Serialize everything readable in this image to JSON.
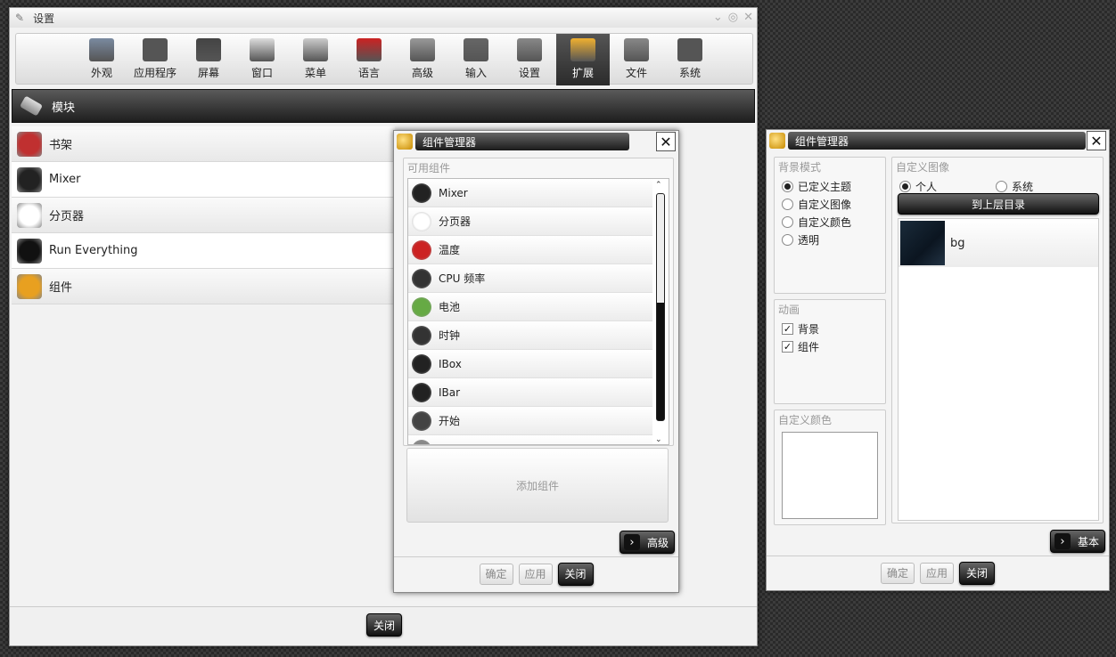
{
  "settings": {
    "title": "设置",
    "toolbar": [
      {
        "label": "外观",
        "icon": "appearance-icon",
        "color": "#7a8aa0"
      },
      {
        "label": "应用程序",
        "icon": "play-icon",
        "color": "#555555"
      },
      {
        "label": "屏幕",
        "icon": "monitor-icon",
        "color": "#444444"
      },
      {
        "label": "窗口",
        "icon": "window-icon",
        "color": "#dddddd"
      },
      {
        "label": "菜单",
        "icon": "menu-icon",
        "color": "#cccccc"
      },
      {
        "label": "语言",
        "icon": "flag-icon",
        "color": "#cc2222"
      },
      {
        "label": "高级",
        "icon": "rocket-icon",
        "color": "#999999"
      },
      {
        "label": "输入",
        "icon": "keyboard-icon",
        "color": "#666666"
      },
      {
        "label": "设置",
        "icon": "wrench-icon",
        "color": "#888888"
      },
      {
        "label": "扩展",
        "icon": "puzzle-icon",
        "color": "#f0b030",
        "active": true
      },
      {
        "label": "文件",
        "icon": "folder-icon",
        "color": "#888888"
      },
      {
        "label": "系统",
        "icon": "laptop-icon",
        "color": "#555555"
      }
    ],
    "section_title": "模块",
    "modules": [
      {
        "label": "书架",
        "icon": "bookshelf-icon",
        "color": "#c03030"
      },
      {
        "label": "Mixer",
        "icon": "speaker-icon",
        "color": "#222222"
      },
      {
        "label": "分页器",
        "icon": "pager-icon",
        "color": "#ffffff"
      },
      {
        "label": "Run Everything",
        "icon": "terminal-icon",
        "color": "#111111"
      },
      {
        "label": "组件",
        "icon": "gadgets-icon",
        "color": "#e8a020"
      }
    ],
    "close_label": "关闭"
  },
  "cm1": {
    "title": "组件管理器",
    "available_label": "可用组件",
    "components": [
      {
        "label": "Mixer",
        "icon": "speaker-icon",
        "color": "#222222"
      },
      {
        "label": "分页器",
        "icon": "pager-icon",
        "color": "#ffffff"
      },
      {
        "label": "温度",
        "icon": "thermometer-icon",
        "color": "#cc2222"
      },
      {
        "label": "CPU 频率",
        "icon": "gauge-icon",
        "color": "#333333"
      },
      {
        "label": "电池",
        "icon": "battery-icon",
        "color": "#66aa44"
      },
      {
        "label": "时钟",
        "icon": "clock-icon",
        "color": "#333333"
      },
      {
        "label": "IBox",
        "icon": "ibox-icon",
        "color": "#222222"
      },
      {
        "label": "IBar",
        "icon": "ibar-icon",
        "color": "#222222"
      },
      {
        "label": "开始",
        "icon": "start-icon",
        "color": "#444444"
      },
      {
        "label": "设置",
        "icon": "wrench-icon",
        "color": "#888888"
      }
    ],
    "add_label": "添加组件",
    "advanced_label": "高级",
    "ok_label": "确定",
    "apply_label": "应用",
    "close_label": "关闭"
  },
  "cm2": {
    "title": "组件管理器",
    "bg_mode_label": "背景模式",
    "bg_modes": [
      {
        "label": "已定义主题",
        "selected": true
      },
      {
        "label": "自定义图像",
        "selected": false
      },
      {
        "label": "自定义颜色",
        "selected": false
      },
      {
        "label": "透明",
        "selected": false
      }
    ],
    "anim_label": "动画",
    "anims": [
      {
        "label": "背景",
        "checked": true
      },
      {
        "label": "组件",
        "checked": true
      }
    ],
    "custom_color_label": "自定义颜色",
    "custom_image_label": "自定义图像",
    "source_personal": "个人",
    "source_system": "系统",
    "up_label": "到上层目录",
    "images": [
      {
        "label": "bg"
      }
    ],
    "basic_label": "基本",
    "ok_label": "确定",
    "apply_label": "应用",
    "close_label": "关闭"
  }
}
